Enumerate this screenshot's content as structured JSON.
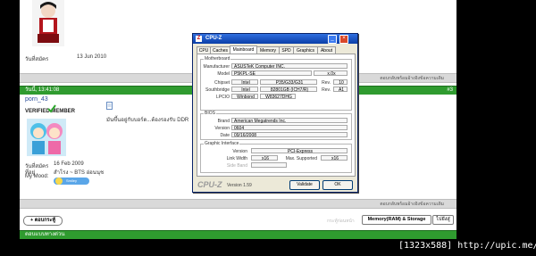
{
  "forum": {
    "post1": {
      "join_label": "วันที่สมัคร",
      "join_date": "13 Jun 2010"
    },
    "bar1": {
      "quote_label": "ตอบกลับพร้อมอ้างอิงข้อความเดิม"
    },
    "post2": {
      "header_date": "วันนี้, 13:41:08",
      "post_number": "#3",
      "username": "porn_43",
      "user_title": "VERIFIED MEMBER",
      "body_text": "มันขึ้นอยู่กับบอร์ด...ต้องรองรับ DDR",
      "join_label": "วันที่สมัคร",
      "join_date": "16 Feb 2009",
      "location_label": "ที่อยู่",
      "location_value": "สำโรง ~ BTS อ่อนนุช",
      "mood_label": "My Mood:",
      "mood_value": "Smiley"
    },
    "bar2": {
      "quote_label": "ตอบกลับพร้อมอ้างอิงข้อความเดิม"
    },
    "bottom": {
      "reply_button": "+ ตอบกระทู้",
      "breadcrumb_hint": "กระทู้ก่อนหน้า",
      "forum_button": "Memory(RAM) & Storage",
      "go_button": "ไปยังสู่",
      "footer_text": "ตอบแบบทางด่วน"
    }
  },
  "cpuz": {
    "title": "CPU-Z",
    "tabs": [
      "CPU",
      "Caches",
      "Mainboard",
      "Memory",
      "SPD",
      "Graphics",
      "About"
    ],
    "active_tab": "Mainboard",
    "motherboard": {
      "section": "Motherboard",
      "manufacturer_label": "Manufacturer",
      "manufacturer": "ASUSTeK Computer INC.",
      "model_label": "Model",
      "model": "P5KPL-SE",
      "model_rev": "x.0x",
      "chipset_label": "Chipset",
      "chipset_vendor": "Intel",
      "chipset": "P35/G33/G31",
      "rev_label": "Rev.",
      "chipset_rev": "10",
      "southbridge_label": "Southbridge",
      "southbridge_vendor": "Intel",
      "southbridge": "82801GB (ICH7/R)",
      "southbridge_rev": "A1",
      "lpcio_label": "LPCIO",
      "lpcio_vendor": "Winbond",
      "lpcio": "W83627DHG"
    },
    "bios": {
      "section": "BIOS",
      "brand_label": "Brand",
      "brand": "American Megatrends Inc.",
      "version_label": "Version",
      "version": "0604",
      "date_label": "Date",
      "date": "09/16/2008"
    },
    "graphic": {
      "section": "Graphic Interface",
      "version_label": "Version",
      "version": "PCI-Express",
      "link_width_label": "Link Width",
      "link_width": "x16",
      "max_supported_label": "Max. Supported",
      "max_supported": "x16",
      "side_band_label": "Side Band"
    },
    "footer": {
      "logo": "CPU-Z",
      "version": "Version 1.59",
      "validate": "Validate",
      "ok": "OK"
    }
  },
  "watermark": "[1323x588] http://upic.me/"
}
